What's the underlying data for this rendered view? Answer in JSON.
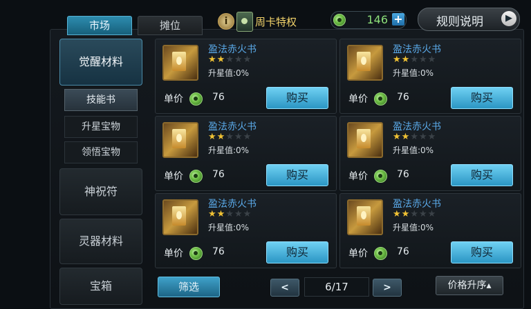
{
  "tabs": [
    "市场",
    "摊位"
  ],
  "header": {
    "info_icon": "i",
    "weekcard_label": "周卡特权",
    "gold_amount": "146",
    "plus_label": "+",
    "rules_label": "规则说明",
    "rules_arrow": "▶"
  },
  "sidebar": {
    "main": [
      "觉醒材料",
      "神祝符",
      "灵器材料",
      "宝箱"
    ],
    "sub": [
      "技能书",
      "升星宝物",
      "领悟宝物"
    ]
  },
  "cards": [
    {
      "name": "盈法赤火书",
      "stars_on": "★★",
      "stars_off": "★★★",
      "star_text": "升星值:0%",
      "price_label": "单价",
      "price": "76",
      "buy": "购买"
    },
    {
      "name": "盈法赤火书",
      "stars_on": "★★",
      "stars_off": "★★★",
      "star_text": "升星值:0%",
      "price_label": "单价",
      "price": "76",
      "buy": "购买"
    },
    {
      "name": "盈法赤火书",
      "stars_on": "★★",
      "stars_off": "★★★",
      "star_text": "升星值:0%",
      "price_label": "单价",
      "price": "76",
      "buy": "购买"
    },
    {
      "name": "盈法赤火书",
      "stars_on": "★★",
      "stars_off": "★★★",
      "star_text": "升星值:0%",
      "price_label": "单价",
      "price": "76",
      "buy": "购买"
    },
    {
      "name": "盈法赤火书",
      "stars_on": "★★",
      "stars_off": "★★★",
      "star_text": "升星值:0%",
      "price_label": "单价",
      "price": "76",
      "buy": "购买"
    },
    {
      "name": "盈法赤火书",
      "stars_on": "★★",
      "stars_off": "★★★",
      "star_text": "升星值:0%",
      "price_label": "单价",
      "price": "76",
      "buy": "购买"
    }
  ],
  "footer": {
    "filter": "筛选",
    "prev": "<",
    "next": ">",
    "page": "6/17",
    "sort": "价格升序▴"
  },
  "colors": {
    "accent": "#2b96c4",
    "item_name": "#5aa9e8",
    "star": "#f0c234",
    "gold_text": "#8de07a"
  }
}
